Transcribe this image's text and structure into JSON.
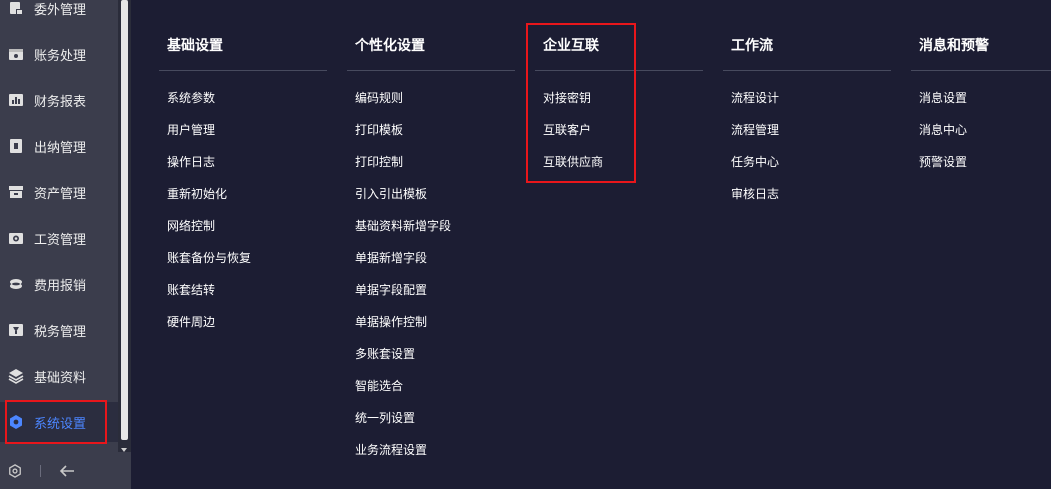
{
  "sidebar": {
    "items": [
      {
        "label": "委外管理",
        "icon": "outsource-icon"
      },
      {
        "label": "账务处理",
        "icon": "ledger-icon"
      },
      {
        "label": "财务报表",
        "icon": "report-icon"
      },
      {
        "label": "出纳管理",
        "icon": "cashier-icon"
      },
      {
        "label": "资产管理",
        "icon": "asset-icon"
      },
      {
        "label": "工资管理",
        "icon": "salary-icon"
      },
      {
        "label": "费用报销",
        "icon": "expense-icon"
      },
      {
        "label": "税务管理",
        "icon": "tax-icon"
      },
      {
        "label": "基础资料",
        "icon": "layers-icon"
      },
      {
        "label": "系统设置",
        "icon": "hexagon-icon",
        "active": true
      }
    ],
    "bottom": {
      "settings_icon": "settings-icon",
      "collapse_icon": "arrow-left-icon"
    }
  },
  "menu": {
    "columns": [
      {
        "title": "基础设置",
        "items": [
          "系统参数",
          "用户管理",
          "操作日志",
          "重新初始化",
          "网络控制",
          "账套备份与恢复",
          "账套结转",
          "硬件周边"
        ]
      },
      {
        "title": "个性化设置",
        "items": [
          "编码规则",
          "打印模板",
          "打印控制",
          "引入引出模板",
          "基础资料新增字段",
          "单据新增字段",
          "单据字段配置",
          "单据操作控制",
          "多账套设置",
          "智能选合",
          "统一列设置",
          "业务流程设置"
        ]
      },
      {
        "title": "企业互联",
        "items": [
          "对接密钥",
          "互联客户",
          "互联供应商"
        ]
      },
      {
        "title": "工作流",
        "items": [
          "流程设计",
          "流程管理",
          "任务中心",
          "审核日志"
        ]
      },
      {
        "title": "消息和预警",
        "items": [
          "消息设置",
          "消息中心",
          "预警设置"
        ]
      }
    ]
  },
  "colors": {
    "active": "#4c86ff",
    "highlight": "#e8161b",
    "background": "#1c1d33",
    "sidebar": "#3b3d4c"
  }
}
